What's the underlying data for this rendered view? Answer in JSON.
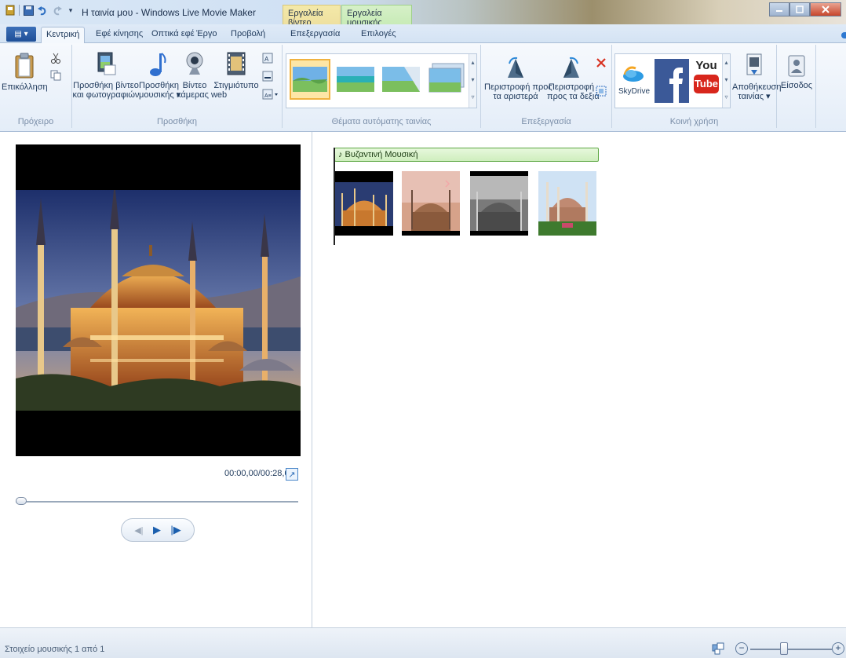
{
  "window": {
    "title": "Η ταινία μου - Windows Live Movie Maker",
    "context_tab_video": "Εργαλεία βίντεο",
    "context_tab_music": "Εργαλεία μουσικής",
    "minimize_icon": "minimize-icon",
    "maximize_icon": "maximize-icon",
    "close_icon": "close-icon"
  },
  "tabs": {
    "home": "Κεντρική",
    "animations": "Εφέ κίνησης",
    "visual_effects": "Οπτικά εφέ",
    "project": "Έργο",
    "view": "Προβολή",
    "edit": "Επεξεργασία",
    "options": "Επιλογές"
  },
  "ribbon": {
    "clipboard": {
      "group_label": "Πρόχειρο",
      "paste": "Επικόλληση"
    },
    "add": {
      "group_label": "Προσθήκη",
      "add_videos_line1": "Προσθήκη βίντεο",
      "add_videos_line2": "και φωτογραφιών",
      "add_music_line1": "Προσθήκη",
      "add_music_line2": "μουσικής ▾",
      "webcam_line1": "Βίντεο",
      "webcam_line2": "κάμερας web",
      "snapshot": "Στιγμιότυπο"
    },
    "automovie": {
      "group_label": "Θέματα αυτόματης ταινίας"
    },
    "editing": {
      "group_label": "Επεξεργασία",
      "rotate_left_line1": "Περιστροφή προς",
      "rotate_left_line2": "τα αριστερά",
      "rotate_right_line1": "Περιστροφή",
      "rotate_right_line2": "προς τα δεξιά"
    },
    "sharing": {
      "group_label": "Κοινή χρήση",
      "skydrive": "SkyDrive",
      "youtube_top": "You",
      "youtube_bottom": "Tube",
      "save_movie_line1": "Αποθήκευση",
      "save_movie_line2": "ταινίας ▾"
    },
    "signin": {
      "label": "Είσοδος"
    }
  },
  "preview": {
    "timecode": "00:00,00/00:28,00",
    "seek_position": 0.0
  },
  "storyboard": {
    "music_track": "♪ Βυζαντινή Μουσική",
    "clip_count": 4
  },
  "status": {
    "text": "Στοιχείο μουσικής 1 από 1",
    "zoom_level": 0.4
  },
  "colors": {
    "accent": "#1f4f97",
    "music_bar": "#cfeebe",
    "selection": "#f0b23f"
  }
}
